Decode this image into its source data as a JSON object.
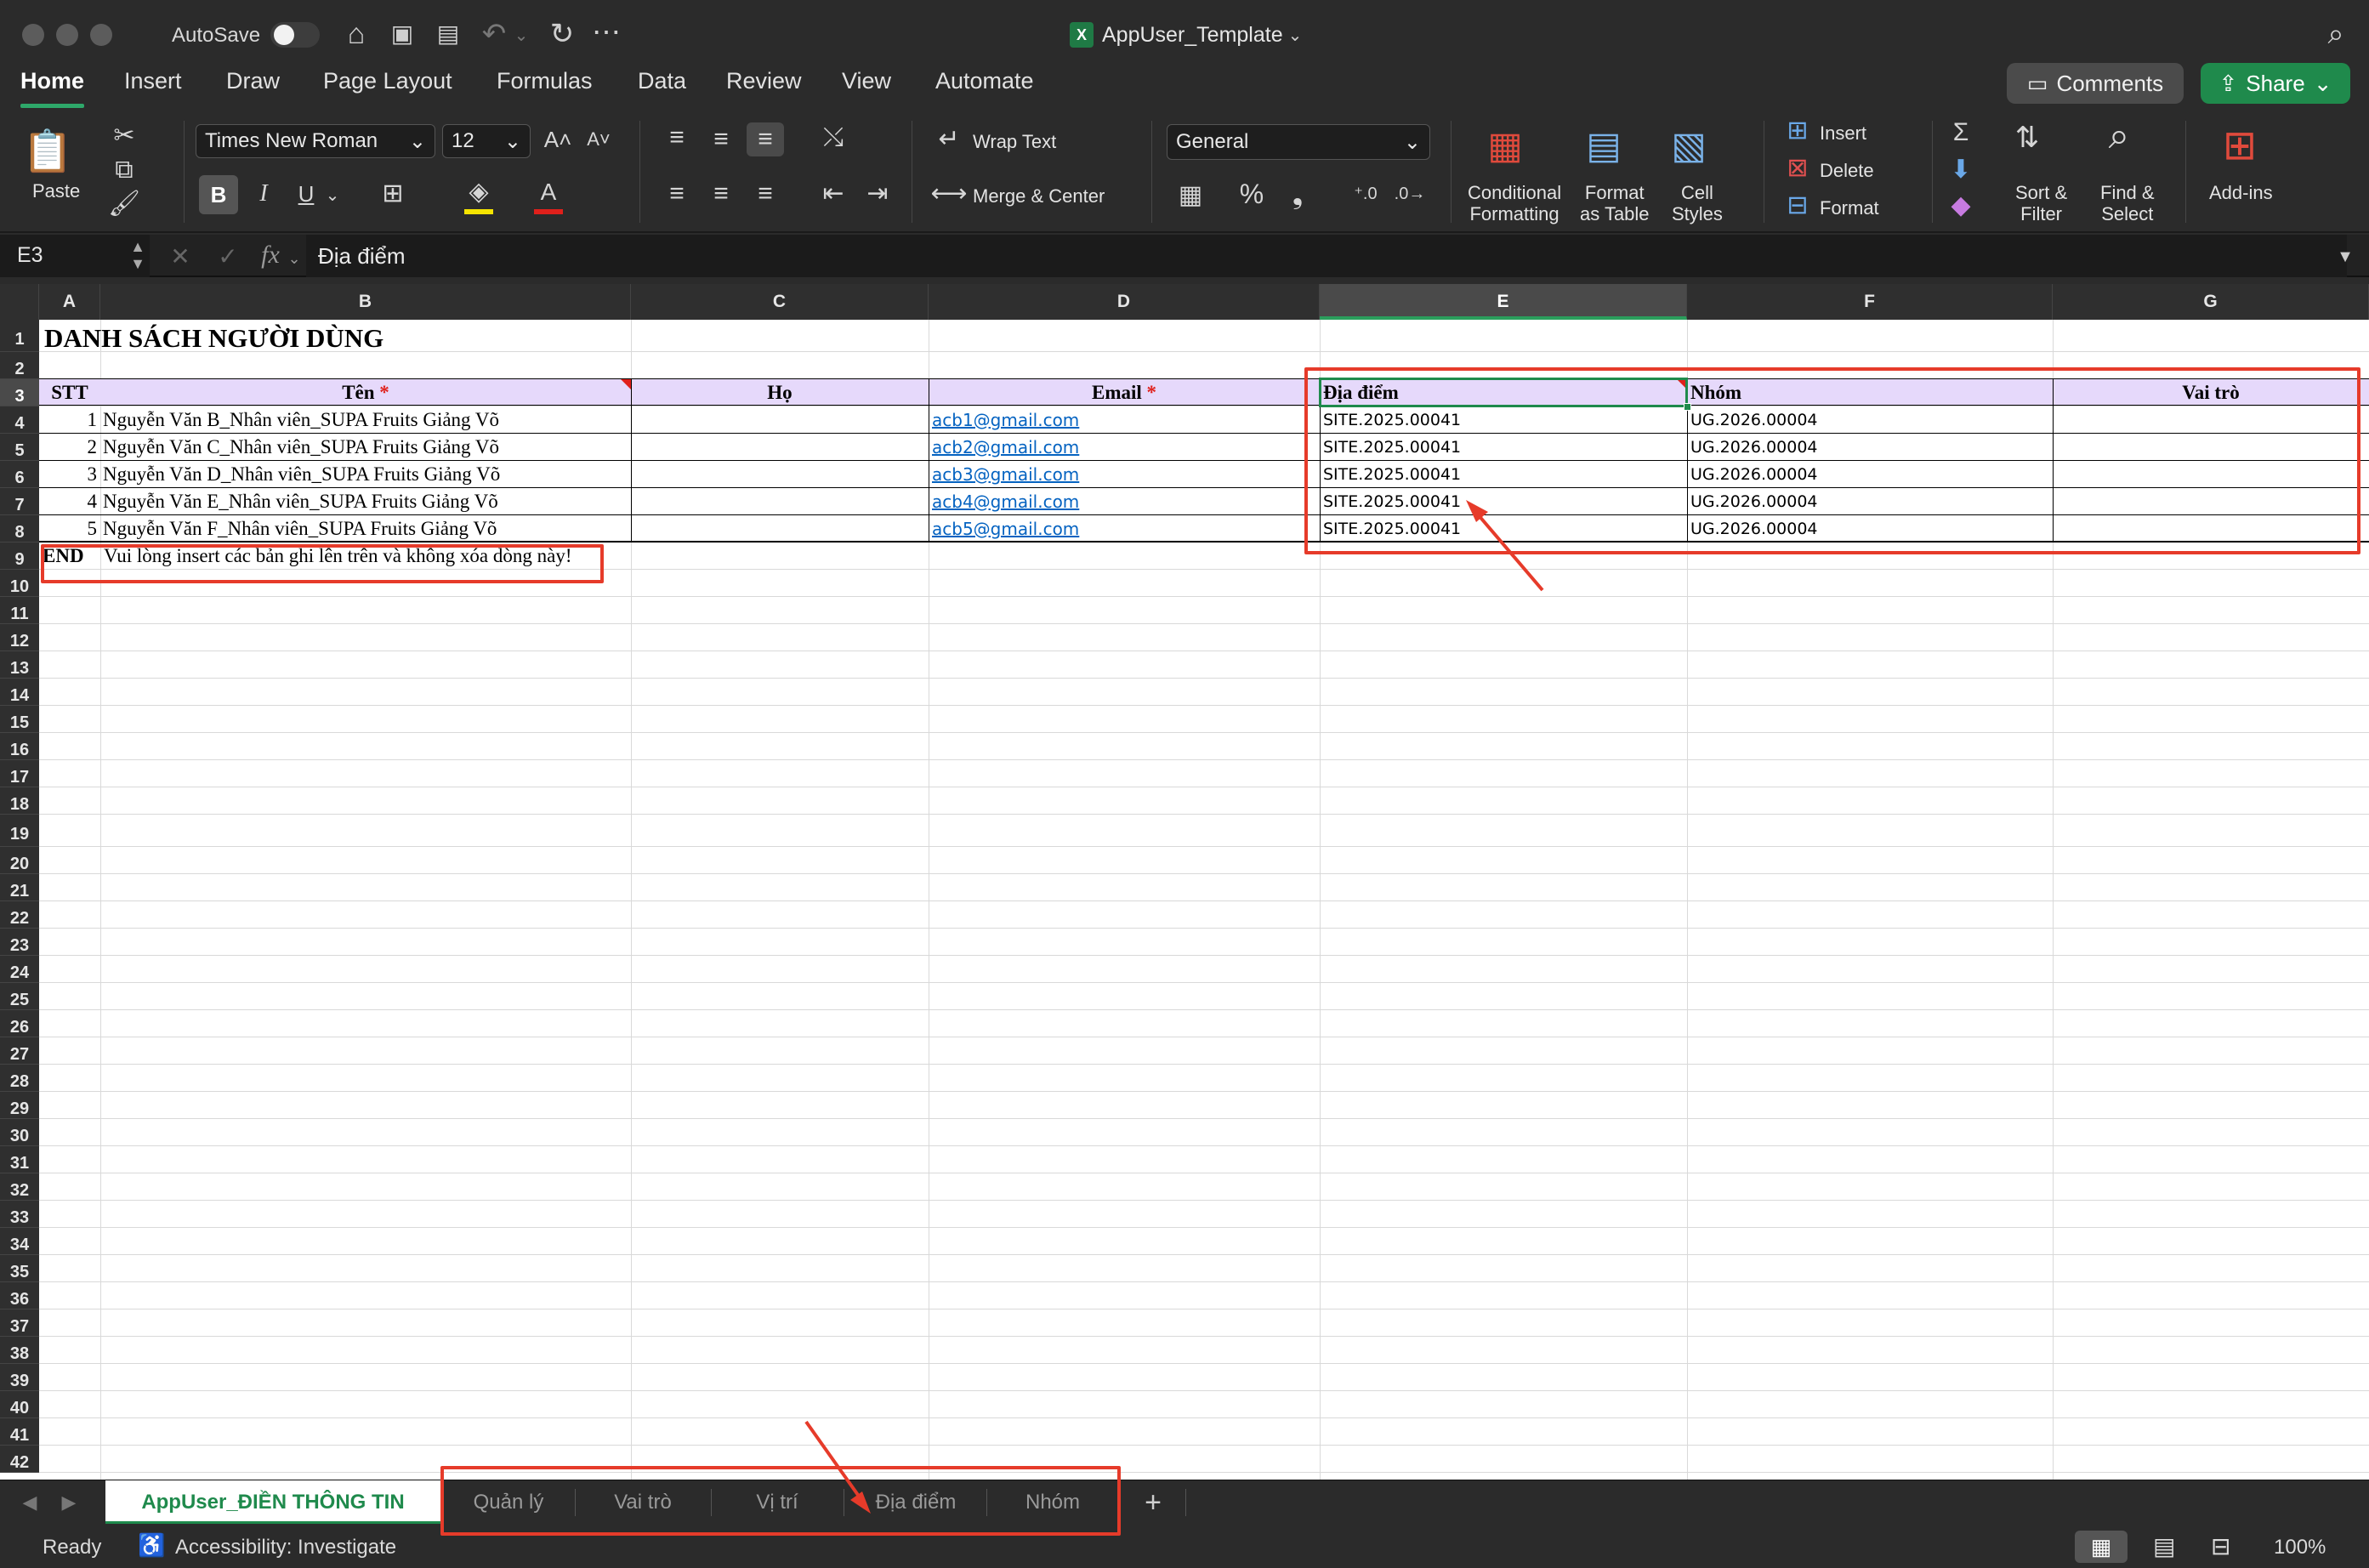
{
  "window": {
    "autosave_label": "AutoSave",
    "title": "AppUser_Template"
  },
  "menu": {
    "items": [
      "Home",
      "Insert",
      "Draw",
      "Page Layout",
      "Formulas",
      "Data",
      "Review",
      "View",
      "Automate"
    ],
    "active": "Home",
    "comments_label": "Comments",
    "share_label": "Share"
  },
  "ribbon": {
    "paste_label": "Paste",
    "font_name": "Times New Roman",
    "font_size": "12",
    "bold": "B",
    "italic": "I",
    "underline": "U",
    "wrap_text": "Wrap Text",
    "merge_center": "Merge & Center",
    "number_format": "General",
    "conditional_formatting": [
      "Conditional",
      "Formatting"
    ],
    "format_as_table": [
      "Format",
      "as Table"
    ],
    "cell_styles": [
      "Cell",
      "Styles"
    ],
    "insert": "Insert",
    "delete": "Delete",
    "format": "Format",
    "sort_filter": [
      "Sort &",
      "Filter"
    ],
    "find_select": [
      "Find &",
      "Select"
    ],
    "add_ins": "Add-ins"
  },
  "formula_bar": {
    "name_box": "E3",
    "fx": "fx",
    "content": "Địa điểm"
  },
  "sheet": {
    "columns": [
      "A",
      "B",
      "C",
      "D",
      "E",
      "F",
      "G"
    ],
    "selected_column": "E",
    "selected_row": 3,
    "title": "DANH SÁCH NGƯỜI DÙNG",
    "headers": {
      "stt": "STT",
      "ten": "Tên",
      "ho": "Họ",
      "email": "Email",
      "dia_diem": "Địa điểm",
      "nhom": "Nhóm",
      "vai_tro": "Vai trò",
      "required_mark": "*"
    },
    "rows": [
      {
        "stt": "1",
        "ten": "Nguyễn Văn B_Nhân viên_SUPA Fruits Giảng Võ",
        "email": "acb1@gmail.com",
        "dia_diem": "SITE.2025.00041",
        "nhom": "UG.2026.00004"
      },
      {
        "stt": "2",
        "ten": "Nguyễn Văn C_Nhân viên_SUPA Fruits Giảng Võ",
        "email": "acb2@gmail.com",
        "dia_diem": "SITE.2025.00041",
        "nhom": "UG.2026.00004"
      },
      {
        "stt": "3",
        "ten": "Nguyễn Văn D_Nhân viên_SUPA Fruits Giảng Võ",
        "email": "acb3@gmail.com",
        "dia_diem": "SITE.2025.00041",
        "nhom": "UG.2026.00004"
      },
      {
        "stt": "4",
        "ten": "Nguyễn Văn E_Nhân viên_SUPA Fruits Giảng Võ",
        "email": "acb4@gmail.com",
        "dia_diem": "SITE.2025.00041",
        "nhom": "UG.2026.00004"
      },
      {
        "stt": "5",
        "ten": "Nguyễn Văn F_Nhân viên_SUPA Fruits Giảng Võ",
        "email": "acb5@gmail.com",
        "dia_diem": "SITE.2025.00041",
        "nhom": "UG.2026.00004"
      }
    ],
    "end_label": "END",
    "end_note": "Vui lòng insert các bản ghi lên trên và không xóa dòng này!"
  },
  "tabs": {
    "active": "AppUser_ĐIỀN THÔNG TIN",
    "others": [
      "Quản lý",
      "Vai trò",
      "Vị trí",
      "Địa điểm",
      "Nhóm"
    ],
    "add": "+"
  },
  "status": {
    "ready": "Ready",
    "accessibility": "Accessibility: Investigate",
    "zoom": "100%"
  },
  "colors": {
    "accent_green": "#1f8a4c",
    "header_band": "#e6d9fb",
    "annotation_red": "#e63b2a",
    "link_blue": "#0563c1"
  }
}
